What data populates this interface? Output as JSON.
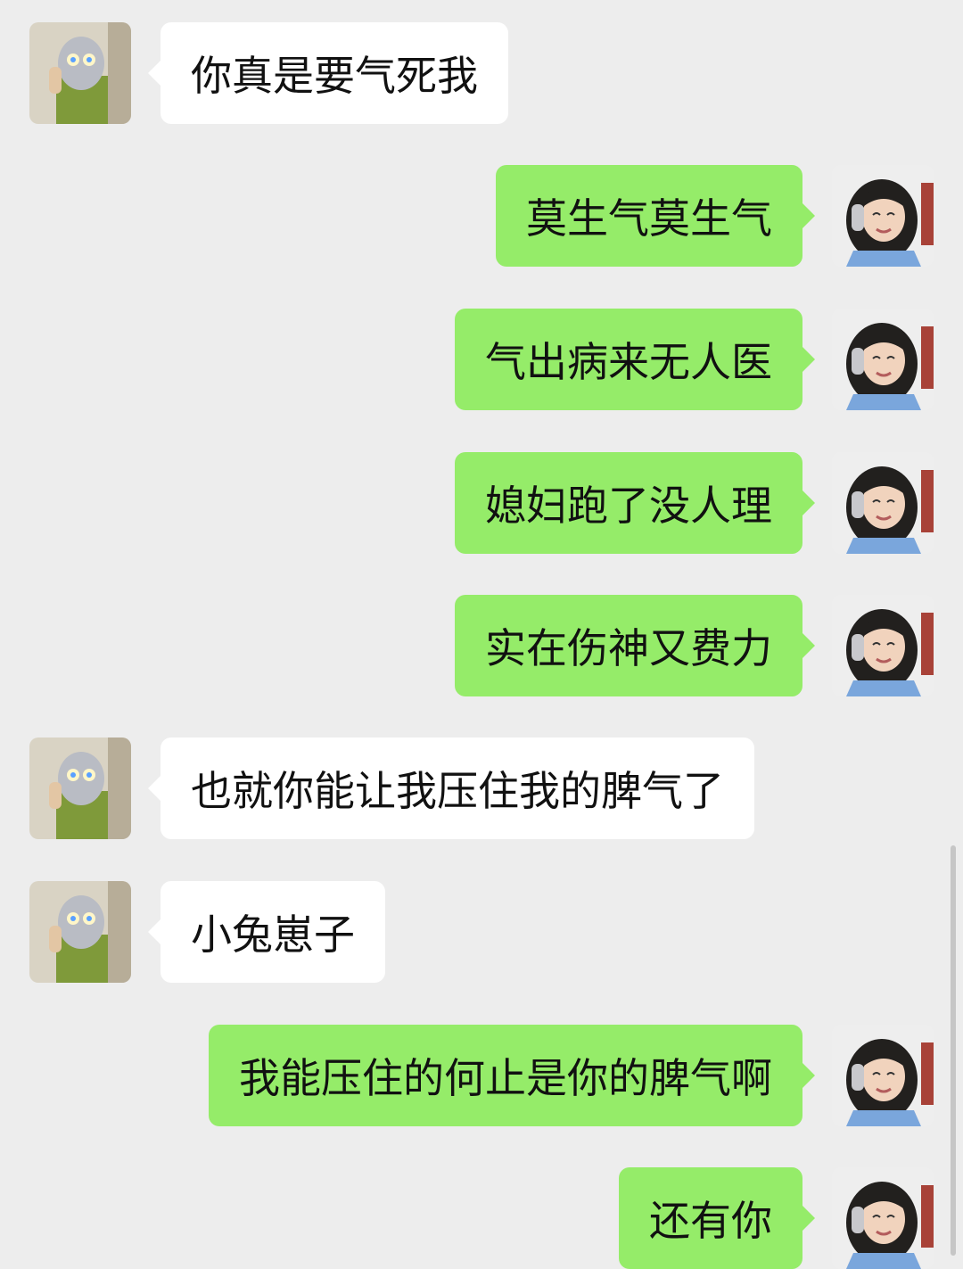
{
  "chat": {
    "colors": {
      "background": "#ededed",
      "incoming_bubble": "#ffffff",
      "outgoing_bubble": "#95ec69",
      "text": "#111111"
    },
    "messages": [
      {
        "side": "left",
        "text": "你真是要气死我",
        "avatar": "contact-avatar-icon"
      },
      {
        "side": "right",
        "text": "莫生气莫生气",
        "avatar": "self-avatar-icon"
      },
      {
        "side": "right",
        "text": "气出病来无人医",
        "avatar": "self-avatar-icon"
      },
      {
        "side": "right",
        "text": "媳妇跑了没人理",
        "avatar": "self-avatar-icon"
      },
      {
        "side": "right",
        "text": "实在伤神又费力",
        "avatar": "self-avatar-icon"
      },
      {
        "side": "left",
        "text": "也就你能让我压住我的脾气了",
        "avatar": "contact-avatar-icon"
      },
      {
        "side": "left",
        "text": "小兔崽子",
        "avatar": "contact-avatar-icon"
      },
      {
        "side": "right",
        "text": "我能压住的何止是你的脾气啊",
        "avatar": "self-avatar-icon"
      },
      {
        "side": "right",
        "text": "还有你",
        "avatar": "self-avatar-icon"
      }
    ]
  }
}
